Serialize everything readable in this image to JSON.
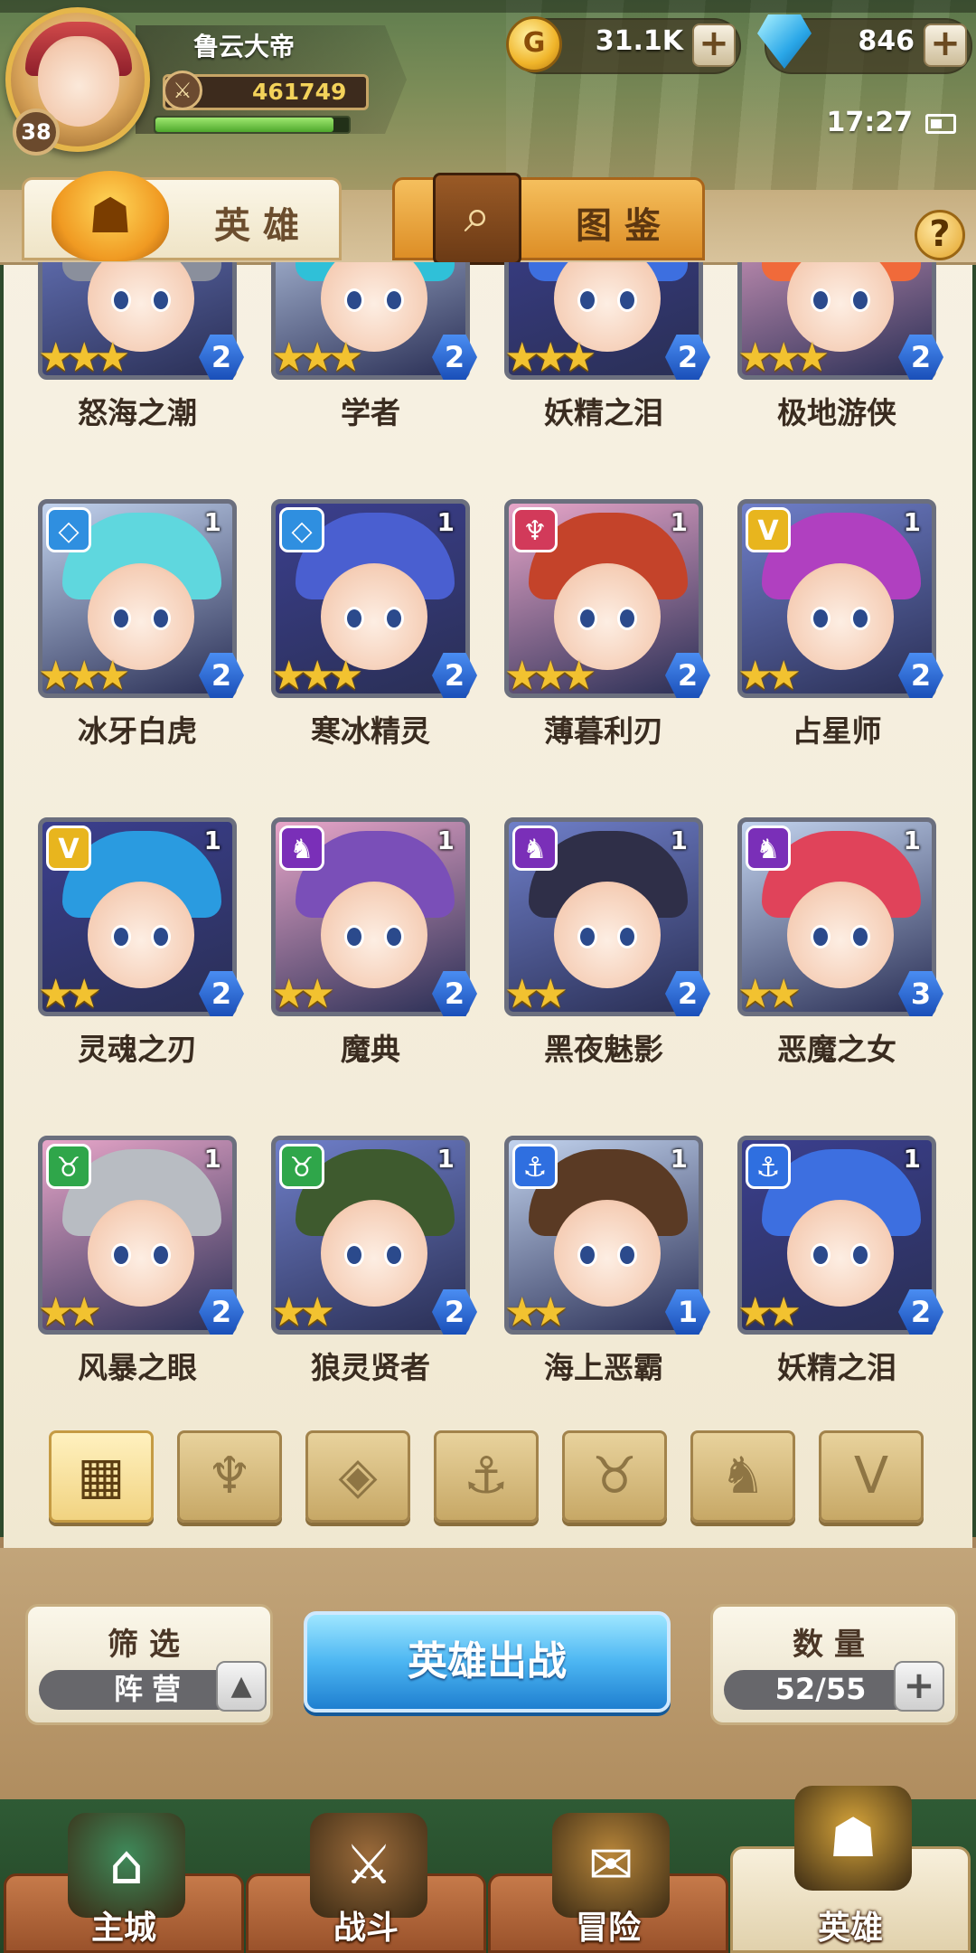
{
  "player": {
    "name": "鲁云大帝",
    "level": "38",
    "power": "461749",
    "exp_progress": 0.92
  },
  "currency": {
    "gold": "31.1K",
    "gems": "846"
  },
  "clock": "17:27",
  "tabs": {
    "heroes": "英雄",
    "codex": "图鉴"
  },
  "heroes": [
    {
      "name": "怒海之潮",
      "stars": 3,
      "level": "2",
      "grade": "",
      "faction": "",
      "hair": "#8a8f9c"
    },
    {
      "name": "学者",
      "stars": 3,
      "level": "2",
      "grade": "",
      "faction": "",
      "hair": "#2fc0d8"
    },
    {
      "name": "妖精之泪",
      "stars": 3,
      "level": "2",
      "grade": "",
      "faction": "",
      "hair": "#3d6fe0"
    },
    {
      "name": "极地游侠",
      "stars": 3,
      "level": "2",
      "grade": "",
      "faction": "",
      "hair": "#f06a3a"
    },
    {
      "name": "冰牙白虎",
      "stars": 3,
      "level": "2",
      "grade": "1",
      "faction": "◇",
      "hair": "#5fd7de"
    },
    {
      "name": "寒冰精灵",
      "stars": 3,
      "level": "2",
      "grade": "1",
      "faction": "◇",
      "hair": "#4a5fd0"
    },
    {
      "name": "薄暮利刃",
      "stars": 3,
      "level": "2",
      "grade": "1",
      "faction": "♆",
      "hair": "#c4432a"
    },
    {
      "name": "占星师",
      "stars": 2,
      "level": "2",
      "grade": "1",
      "faction": "V",
      "hair": "#b040c0"
    },
    {
      "name": "灵魂之刃",
      "stars": 2,
      "level": "2",
      "grade": "1",
      "faction": "V",
      "hair": "#2a9be0"
    },
    {
      "name": "魔典",
      "stars": 2,
      "level": "2",
      "grade": "1",
      "faction": "♞",
      "hair": "#7a4fb8"
    },
    {
      "name": "黑夜魅影",
      "stars": 2,
      "level": "2",
      "grade": "1",
      "faction": "♞",
      "hair": "#2f2f48"
    },
    {
      "name": "恶魔之女",
      "stars": 2,
      "level": "3",
      "grade": "1",
      "faction": "♞",
      "hair": "#e0435a"
    },
    {
      "name": "风暴之眼",
      "stars": 2,
      "level": "2",
      "grade": "1",
      "faction": "♉",
      "hair": "#b8bcc2"
    },
    {
      "name": "狼灵贤者",
      "stars": 2,
      "level": "2",
      "grade": "1",
      "faction": "♉",
      "hair": "#3e5a2e"
    },
    {
      "name": "海上恶霸",
      "stars": 2,
      "level": "1",
      "grade": "1",
      "faction": "⚓",
      "hair": "#5a3a24"
    },
    {
      "name": "妖精之泪",
      "stars": 2,
      "level": "2",
      "grade": "1",
      "faction": "⚓",
      "hair": "#3d6fe0"
    }
  ],
  "faction_colors": {
    "◇": "#2f8fe0",
    "♆": "#d23a5a",
    "V": "#e8b51e",
    "♞": "#7a2fb8",
    "♉": "#2fa64a",
    "⚓": "#2f6fe0",
    "": "transparent"
  },
  "filters": [
    "▦",
    "♆",
    "◈",
    "⚓",
    "♉",
    "♞",
    "V"
  ],
  "bottom": {
    "filter_title": "筛选",
    "faction_label": "阵营",
    "deploy_label": "英雄出战",
    "count_title": "数量",
    "count_value": "52/55"
  },
  "nav": [
    {
      "label": "主城",
      "icon": "castle-icon"
    },
    {
      "label": "战斗",
      "icon": "crossed-swords-icon"
    },
    {
      "label": "冒险",
      "icon": "scroll-icon"
    },
    {
      "label": "英雄",
      "icon": "helmet-icon"
    }
  ]
}
